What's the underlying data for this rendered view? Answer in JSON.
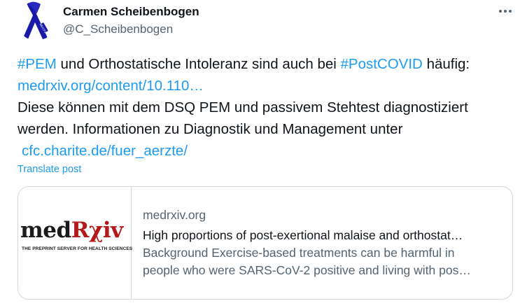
{
  "author": {
    "name": "Carmen Scheibenbogen",
    "handle": "@C_Scheibenbogen",
    "avatar_icon": "blue-ribbon-icon",
    "avatar_badge": "ME/CFS"
  },
  "more_icon": "more-dots-icon",
  "tweet": {
    "line1": {
      "hashtag1": "#PEM",
      "text1": " und Orthostatische Intoleranz sind auch bei ",
      "hashtag2": "#PostCOVID",
      "text2": " häufig:"
    },
    "link1": "medrxiv.org/content/10.110…",
    "line3": "Diese können mit dem DSQ PEM und passivem Stehtest diagnostiziert",
    "line4": "werden. Informationen zu Diagnostik und Management unter",
    "link2": "cfc.charite.de/fuer_aerzte/"
  },
  "translate_label": "Translate post",
  "card": {
    "logo_pre": "med",
    "logo_accent": "Rχiv",
    "logo_tagline": "THE PREPRINT SERVER FOR HEALTH SCIENCES",
    "domain": "medrxiv.org",
    "title": "High proportions of post-exertional malaise and orthostat…",
    "desc_line1": "Background Exercise-based treatments can be harmful in",
    "desc_line2": "people who were SARS-CoV-2 positive and living with pos…"
  },
  "colors": {
    "link": "#1d9bf0",
    "secondary_text": "#536471",
    "ribbon": "#1a1aa8",
    "logo_accent": "#b31b1b"
  }
}
